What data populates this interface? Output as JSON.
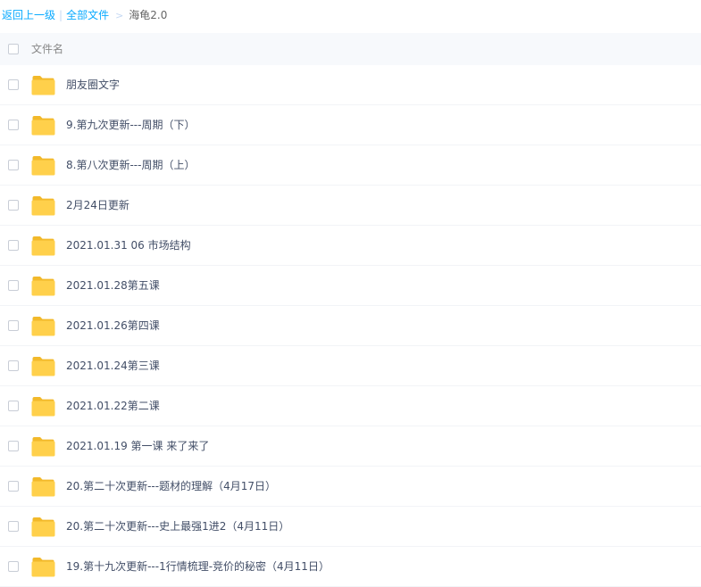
{
  "breadcrumb": {
    "back": "返回上一级",
    "separator": "|",
    "all_files": "全部文件",
    "arrow": ">",
    "current": "海龟2.0"
  },
  "header": {
    "column_name": "文件名"
  },
  "icon": "folder-icon",
  "colors": {
    "link": "#09aaff",
    "folder": "#ffd04b",
    "header_bg": "#f7f9fc"
  },
  "files": [
    {
      "name": "朋友圈文字"
    },
    {
      "name": "9.第九次更新---周期（下）"
    },
    {
      "name": "8.第八次更新---周期（上）"
    },
    {
      "name": "2月24日更新"
    },
    {
      "name": "2021.01.31 06 市场结构"
    },
    {
      "name": "2021.01.28第五课"
    },
    {
      "name": "2021.01.26第四课"
    },
    {
      "name": "2021.01.24第三课"
    },
    {
      "name": "2021.01.22第二课"
    },
    {
      "name": "2021.01.19 第一课 来了来了"
    },
    {
      "name": "20.第二十次更新---题材的理解（4月17日）"
    },
    {
      "name": "20.第二十次更新---史上最强1进2（4月11日）"
    },
    {
      "name": "19.第十九次更新---1行情梳理-竞价的秘密（4月11日）"
    }
  ]
}
